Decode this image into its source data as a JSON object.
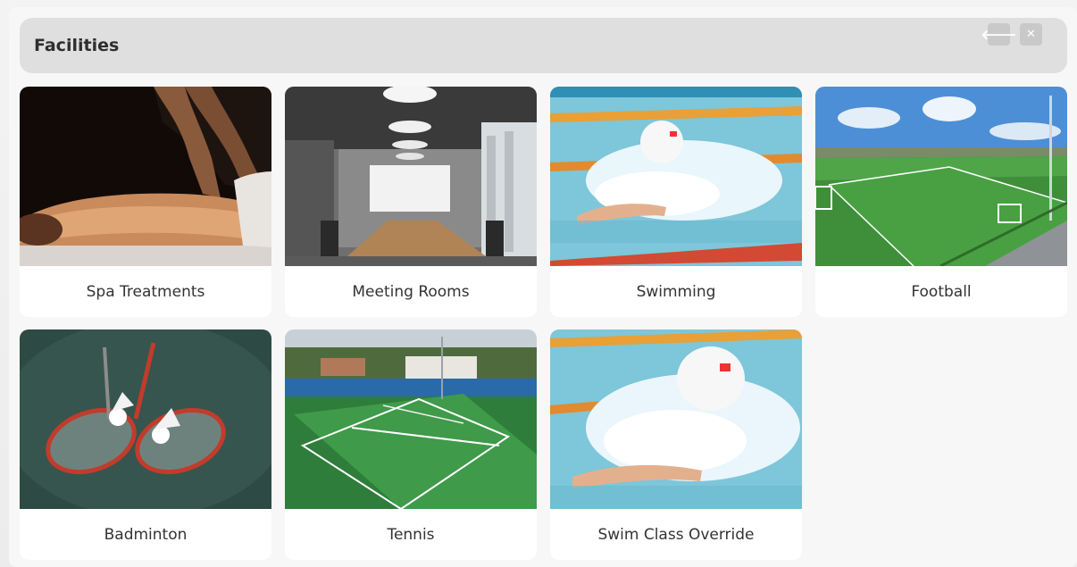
{
  "modal": {
    "title": "Facilities",
    "back_icon": "arrow-left-icon",
    "close_icon": "close-icon",
    "back_glyph": "🡐",
    "close_glyph": "✕"
  },
  "facilities": [
    {
      "label": "Spa Treatments",
      "image": "spa-massage-photo"
    },
    {
      "label": "Meeting Rooms",
      "image": "meeting-room-photo"
    },
    {
      "label": "Swimming",
      "image": "swimmer-photo"
    },
    {
      "label": "Football",
      "image": "football-pitch-photo"
    },
    {
      "label": "Badminton",
      "image": "badminton-rackets-photo"
    },
    {
      "label": "Tennis",
      "image": "tennis-court-photo"
    },
    {
      "label": "Swim Class Override",
      "image": "swimmer-closeup-photo"
    }
  ],
  "colors": {
    "header_bg": "#dfdfdf",
    "card_bg": "#ffffff",
    "button_bg": "#c9c9c9"
  }
}
